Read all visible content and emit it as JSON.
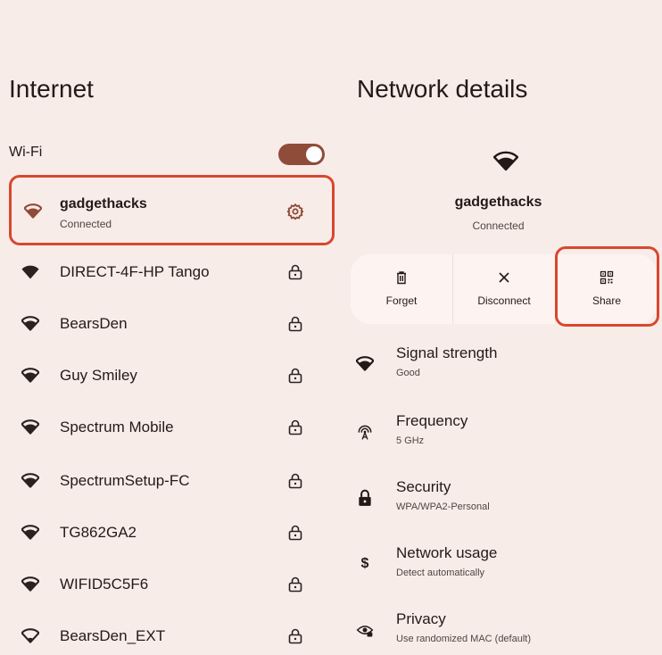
{
  "internet": {
    "title": "Internet",
    "wifi_label": "Wi-Fi",
    "wifi_enabled": true,
    "connected": {
      "name": "gadgethacks",
      "status": "Connected"
    },
    "networks": [
      {
        "name": "DIRECT-4F-HP Tango",
        "signal_icon": "wifi-full-icon"
      },
      {
        "name": "BearsDen",
        "signal_icon": "wifi-icon"
      },
      {
        "name": "Guy Smiley",
        "signal_icon": "wifi-icon"
      },
      {
        "name": "Spectrum Mobile",
        "signal_icon": "wifi-icon"
      },
      {
        "name": "SpectrumSetup-FC",
        "signal_icon": "wifi-icon"
      },
      {
        "name": "TG862GA2",
        "signal_icon": "wifi-icon"
      },
      {
        "name": "WIFID5C5F6",
        "signal_icon": "wifi-icon"
      },
      {
        "name": "BearsDen_EXT",
        "signal_icon": "wifi-weak-icon"
      }
    ]
  },
  "details": {
    "title": "Network details",
    "network_name": "gadgethacks",
    "network_status": "Connected",
    "actions": [
      {
        "label": "Forget",
        "icon": "trash-icon"
      },
      {
        "label": "Disconnect",
        "icon": "close-icon"
      },
      {
        "label": "Share",
        "icon": "qr-code-icon"
      }
    ],
    "items": [
      {
        "title": "Signal strength",
        "subtitle": "Good",
        "icon": "wifi-icon"
      },
      {
        "title": "Frequency",
        "subtitle": "5 GHz",
        "icon": "antenna-icon"
      },
      {
        "title": "Security",
        "subtitle": "WPA/WPA2-Personal",
        "icon": "lock-icon"
      },
      {
        "title": "Network usage",
        "subtitle": "Detect automatically",
        "icon": "dollar-icon",
        "glyph": "$"
      },
      {
        "title": "Privacy",
        "subtitle": "Use randomized MAC (default)",
        "icon": "privacy-eye-icon"
      }
    ]
  },
  "colors": {
    "background": "#f8ece9",
    "accent": "#8f4c38",
    "highlight_outline": "#d9472f"
  }
}
